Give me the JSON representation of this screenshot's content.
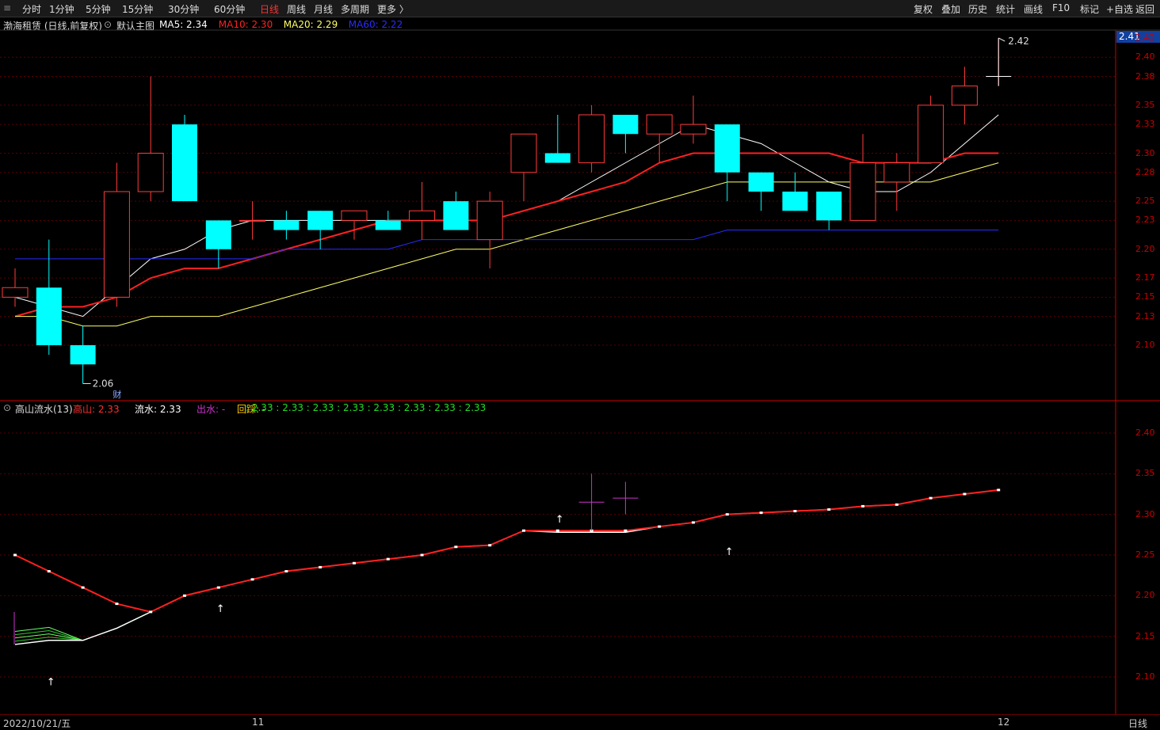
{
  "toolbar": {
    "menu_icon": "≡",
    "periods": [
      "分时",
      "1分钟",
      "5分钟",
      "15分钟",
      "30分钟",
      "60分钟",
      "日线",
      "周线",
      "月线",
      "多周期",
      "更多 〉"
    ],
    "active_period": "日线",
    "right_buttons": [
      "复权",
      "叠加",
      "历史",
      "统计",
      "画线",
      "F10",
      "标记",
      "+自选",
      "返回"
    ]
  },
  "main_panel": {
    "title": "渤海租赁 (日线,前复权)",
    "indicator_name": "默认主图",
    "ma_labels": [
      {
        "text": "MA5: 2.34",
        "color": "#ffffff"
      },
      {
        "text": "MA10: 2.30",
        "color": "#ff2020"
      },
      {
        "text": "MA20: 2.29",
        "color": "#ffff66"
      },
      {
        "text": "MA60: 2.22",
        "color": "#2a2aff"
      }
    ],
    "current_price_tag": "2.41",
    "high_label": "2.42",
    "low_label": "2.06",
    "marker": "财",
    "right_axis_ticks": [
      "2.42",
      "2.40",
      "2.38",
      "2.35",
      "2.33",
      "2.30",
      "2.28",
      "2.25",
      "2.23",
      "2.20",
      "2.17",
      "2.15",
      "2.13",
      "2.10"
    ]
  },
  "sub_panel": {
    "indicator_name": "高山流水(13)",
    "labels": [
      {
        "text": "高山: 2.33",
        "color": "#ff3030"
      },
      {
        "text": "流水: 2.33",
        "color": "#ffffff"
      },
      {
        "text": "出水: -",
        "color": "#cc33cc"
      },
      {
        "text": "回踩: -",
        "color": "#ffcc00"
      }
    ],
    "values_text": ": 2.33 : 2.33 : 2.33 : 2.33 : 2.33 : 2.33 : 2.33 : 2.33",
    "right_axis_ticks": [
      "2.40",
      "2.35",
      "2.30",
      "2.25",
      "2.20",
      "2.15",
      "2.10"
    ]
  },
  "bottom_bar": {
    "date": "2022/10/21/五",
    "month_markers": [
      "11",
      "12"
    ],
    "period_label": "日线"
  },
  "colors": {
    "up": "#ff3b3b",
    "down": "#00ffff",
    "grid": "#5a0000",
    "axis": "#cc0000"
  },
  "chart_data": [
    {
      "type": "candlestick",
      "title": "渤海租赁 (日线,前复权)",
      "ylim": [
        2.05,
        2.44
      ],
      "series": [
        {
          "name": "OHLC",
          "values": [
            [
              2.15,
              2.18,
              2.14,
              2.16
            ],
            [
              2.16,
              2.21,
              2.09,
              2.1
            ],
            [
              2.1,
              2.12,
              2.06,
              2.08
            ],
            [
              2.15,
              2.29,
              2.14,
              2.26
            ],
            [
              2.26,
              2.38,
              2.25,
              2.3
            ],
            [
              2.33,
              2.34,
              2.25,
              2.25
            ],
            [
              2.23,
              2.23,
              2.18,
              2.2
            ],
            [
              2.23,
              2.25,
              2.21,
              2.23
            ],
            [
              2.23,
              2.24,
              2.21,
              2.22
            ],
            [
              2.24,
              2.24,
              2.2,
              2.22
            ],
            [
              2.23,
              2.24,
              2.21,
              2.24
            ],
            [
              2.23,
              2.24,
              2.22,
              2.22
            ],
            [
              2.23,
              2.27,
              2.21,
              2.24
            ],
            [
              2.25,
              2.26,
              2.22,
              2.22
            ],
            [
              2.21,
              2.26,
              2.18,
              2.25
            ],
            [
              2.28,
              2.32,
              2.25,
              2.32
            ],
            [
              2.3,
              2.34,
              2.29,
              2.29
            ],
            [
              2.29,
              2.35,
              2.28,
              2.34
            ],
            [
              2.34,
              2.34,
              2.3,
              2.32
            ],
            [
              2.32,
              2.34,
              2.29,
              2.34
            ],
            [
              2.32,
              2.36,
              2.31,
              2.33
            ],
            [
              2.33,
              2.33,
              2.25,
              2.28
            ],
            [
              2.28,
              2.28,
              2.24,
              2.26
            ],
            [
              2.26,
              2.28,
              2.24,
              2.24
            ],
            [
              2.26,
              2.26,
              2.22,
              2.23
            ],
            [
              2.23,
              2.32,
              2.23,
              2.29
            ],
            [
              2.27,
              2.3,
              2.24,
              2.29
            ],
            [
              2.29,
              2.36,
              2.29,
              2.35
            ],
            [
              2.35,
              2.39,
              2.33,
              2.37
            ],
            [
              2.37,
              2.42,
              2.37,
              2.38
            ]
          ]
        },
        {
          "name": "MA5",
          "values": [
            2.15,
            2.14,
            2.13,
            2.16,
            2.19,
            2.2,
            2.22,
            2.23,
            2.23,
            2.23,
            2.23,
            2.23,
            2.23,
            2.23,
            2.23,
            2.24,
            2.25,
            2.27,
            2.29,
            2.31,
            2.33,
            2.32,
            2.31,
            2.29,
            2.27,
            2.26,
            2.26,
            2.28,
            2.31,
            2.34
          ]
        },
        {
          "name": "MA10",
          "values": [
            2.13,
            2.14,
            2.14,
            2.15,
            2.17,
            2.18,
            2.18,
            2.19,
            2.2,
            2.21,
            2.22,
            2.23,
            2.23,
            2.23,
            2.23,
            2.24,
            2.25,
            2.26,
            2.27,
            2.29,
            2.3,
            2.3,
            2.3,
            2.3,
            2.3,
            2.29,
            2.29,
            2.29,
            2.3,
            2.3
          ]
        },
        {
          "name": "MA20",
          "values": [
            2.13,
            2.13,
            2.12,
            2.12,
            2.13,
            2.13,
            2.13,
            2.14,
            2.15,
            2.16,
            2.17,
            2.18,
            2.19,
            2.2,
            2.2,
            2.21,
            2.22,
            2.23,
            2.24,
            2.25,
            2.26,
            2.27,
            2.27,
            2.27,
            2.27,
            2.27,
            2.27,
            2.27,
            2.28,
            2.29
          ]
        },
        {
          "name": "MA60",
          "values": [
            2.19,
            2.19,
            2.19,
            2.19,
            2.19,
            2.19,
            2.19,
            2.19,
            2.2,
            2.2,
            2.2,
            2.2,
            2.21,
            2.21,
            2.21,
            2.21,
            2.21,
            2.21,
            2.21,
            2.21,
            2.21,
            2.22,
            2.22,
            2.22,
            2.22,
            2.22,
            2.22,
            2.22,
            2.22,
            2.22
          ]
        }
      ]
    },
    {
      "type": "line",
      "title": "高山流水(13)",
      "ylim": [
        2.08,
        2.44
      ],
      "series": [
        {
          "name": "高山",
          "values": [
            2.25,
            2.23,
            2.21,
            2.19,
            2.18,
            2.2,
            2.21,
            2.22,
            2.23,
            2.235,
            2.24,
            2.245,
            2.25,
            2.26,
            2.262,
            2.28,
            2.28,
            2.28,
            2.28,
            2.285,
            2.29,
            2.3,
            2.302,
            2.304,
            2.306,
            2.31,
            2.312,
            2.32,
            2.325,
            2.33
          ]
        },
        {
          "name": "流水",
          "values": [
            2.14,
            2.145,
            2.145,
            2.16,
            2.18,
            2.2,
            2.21,
            2.22,
            2.23,
            2.235,
            2.24,
            2.245,
            2.25,
            2.26,
            2.262,
            2.28,
            2.278,
            2.278,
            2.278,
            2.285,
            2.29,
            2.3,
            2.302,
            2.304,
            2.306,
            2.31,
            2.312,
            2.32,
            2.325,
            2.33
          ]
        }
      ]
    }
  ]
}
